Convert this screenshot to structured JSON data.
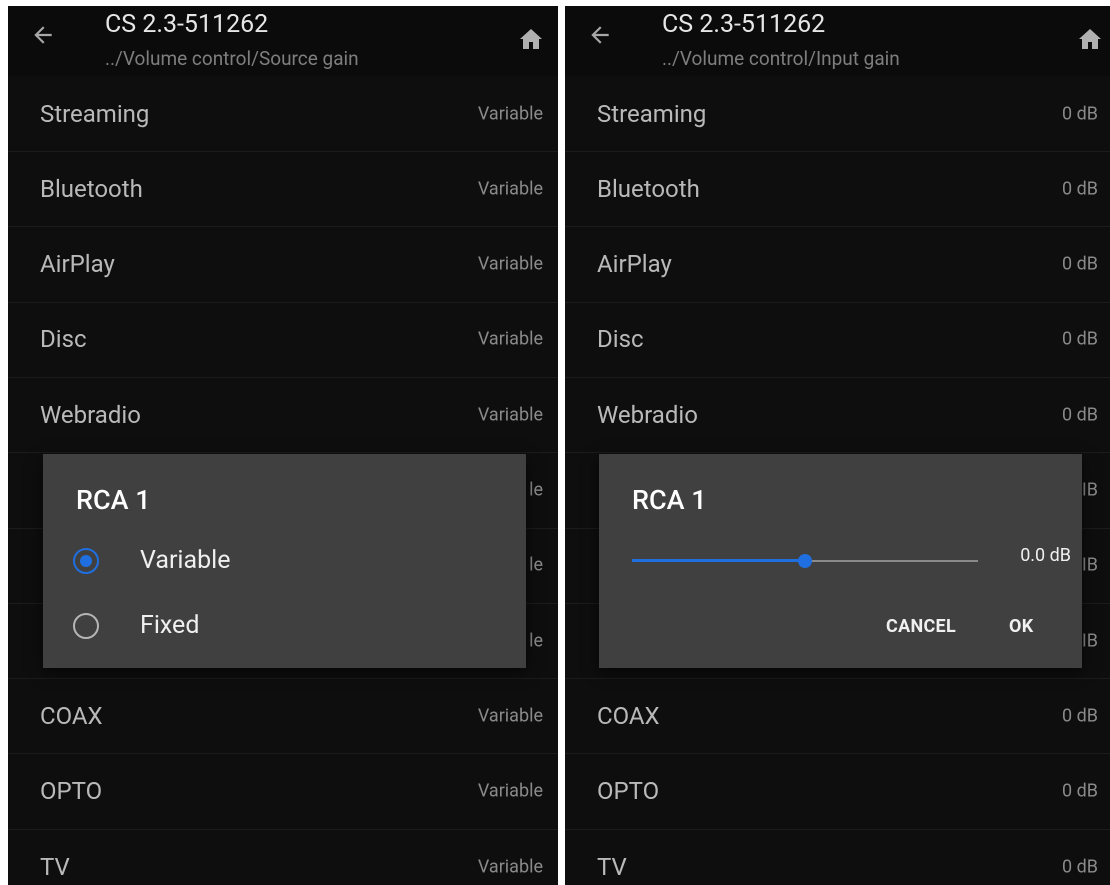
{
  "left": {
    "title": "CS 2.3-511262",
    "subtitle": "../Volume control/Source gain",
    "rows": [
      {
        "label": "Streaming",
        "value": "Variable"
      },
      {
        "label": "Bluetooth",
        "value": "Variable"
      },
      {
        "label": "AirPlay",
        "value": "Variable"
      },
      {
        "label": "Disc",
        "value": "Variable"
      },
      {
        "label": "Webradio",
        "value": "Variable"
      },
      {
        "label": "",
        "value": "le"
      },
      {
        "label": "",
        "value": "le"
      },
      {
        "label": "",
        "value": "le"
      },
      {
        "label": "COAX",
        "value": "Variable"
      },
      {
        "label": "OPTO",
        "value": "Variable"
      },
      {
        "label": "TV",
        "value": "Variable"
      }
    ],
    "dialog": {
      "title": "RCA 1",
      "options": [
        {
          "label": "Variable",
          "selected": true
        },
        {
          "label": "Fixed",
          "selected": false
        }
      ]
    }
  },
  "right": {
    "title": "CS 2.3-511262",
    "subtitle": "../Volume control/Input gain",
    "rows": [
      {
        "label": "Streaming",
        "value": "0 dB"
      },
      {
        "label": "Bluetooth",
        "value": "0 dB"
      },
      {
        "label": "AirPlay",
        "value": "0 dB"
      },
      {
        "label": "Disc",
        "value": "0 dB"
      },
      {
        "label": "Webradio",
        "value": "0 dB"
      },
      {
        "label": "",
        "value": "IB"
      },
      {
        "label": "",
        "value": "IB"
      },
      {
        "label": "",
        "value": "IB"
      },
      {
        "label": "COAX",
        "value": "0 dB"
      },
      {
        "label": "OPTO",
        "value": "0 dB"
      },
      {
        "label": "TV",
        "value": "0 dB"
      }
    ],
    "dialog": {
      "title": "RCA 1",
      "slider_value_label": "0.0 dB",
      "slider_fraction": 0.5,
      "cancel_label": "CANCEL",
      "ok_label": "OK"
    }
  },
  "icons": {
    "back": "arrow-left-icon",
    "home": "home-icon"
  },
  "colors": {
    "accent": "#1f6fe0",
    "background": "#0e0e0e",
    "dialog": "#404040"
  }
}
